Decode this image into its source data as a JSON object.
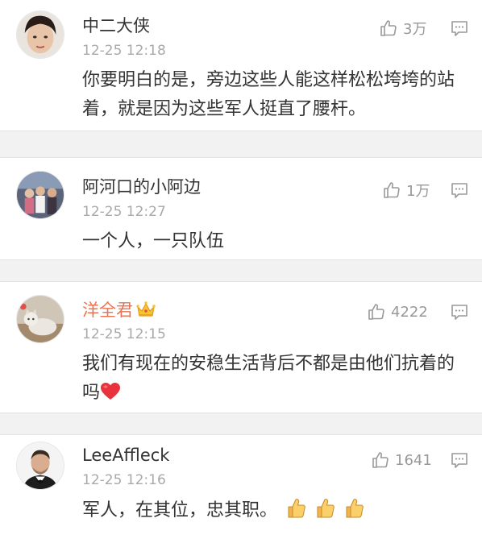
{
  "comments": [
    {
      "username": "中二大侠",
      "time": "12-25 12:18",
      "likes": "3万",
      "text": "你要明白的是，旁边这些人能这样松松垮垮的站着，就是因为这些军人挺直了腰杆。",
      "avatar": "avatar-photo-icon"
    },
    {
      "username": "阿河口的小阿边",
      "time": "12-25 12:27",
      "likes": "1万",
      "text": "一个人，一只队伍",
      "avatar": "avatar-photo-icon"
    },
    {
      "username": "洋全君",
      "time": "12-25 12:15",
      "likes": "4222",
      "text": "我们有现在的安稳生活背后不都是由他们抗着的吗",
      "badge": "crown-icon",
      "trailing_emoji": "heart-icon",
      "avatar": "avatar-photo-icon"
    },
    {
      "username": "LeeAffleck",
      "time": "12-25 12:16",
      "likes": "1641",
      "text": "军人，在其位，忠其职。",
      "trailing_emoji": "thumbs-up-icon",
      "trailing_emoji_count": 3,
      "avatar": "avatar-photo-icon"
    }
  ],
  "colors": {
    "vip_name": "#eb7350",
    "text": "#333333",
    "meta": "#a9a9a9",
    "separator": "#f2f2f2"
  },
  "icons": {
    "like": "thumbs-up-outline-icon",
    "reply": "comment-bubble-icon"
  }
}
